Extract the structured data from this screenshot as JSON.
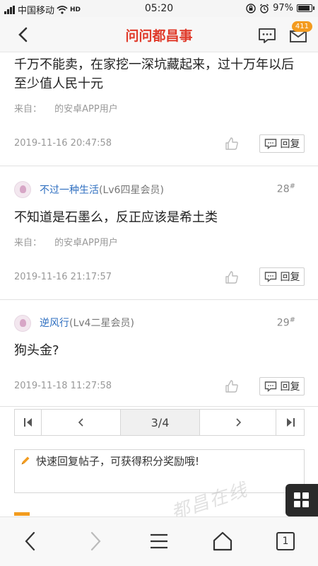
{
  "status_bar": {
    "carrier": "中国移动",
    "network": "HD",
    "time": "05:20",
    "battery": "97%",
    "battery_level": 0.97
  },
  "header": {
    "title": "问问都昌事",
    "mail_badge": "411"
  },
  "posts": [
    {
      "content": "千万不能卖，在家挖一深坑藏起来，过十万年以后至少值人民十元",
      "from_label": "来自：",
      "from_source": "的安卓APP用户",
      "time": "2019-11-16 20:47:58",
      "reply_label": "回复"
    },
    {
      "user": "不过一种生活",
      "level": "(Lv6四星会员)",
      "floor": "28",
      "floor_mark": "#",
      "content": "不知道是石墨么，反正应该是希土类",
      "from_label": "来自：",
      "from_source": "的安卓APP用户",
      "time": "2019-11-16 21:17:57",
      "reply_label": "回复"
    },
    {
      "user": "逆风行",
      "level": "(Lv4二星会员)",
      "floor": "29",
      "floor_mark": "#",
      "content": "狗头金?",
      "time": "2019-11-18 11:27:58",
      "reply_label": "回复"
    }
  ],
  "pagination": {
    "current": "3/4"
  },
  "quick_reply": {
    "placeholder": "快速回复帖子，可获得积分奖励哦!"
  },
  "watermark": "都昌在线",
  "bottom_nav": {
    "tab_count": "1"
  }
}
